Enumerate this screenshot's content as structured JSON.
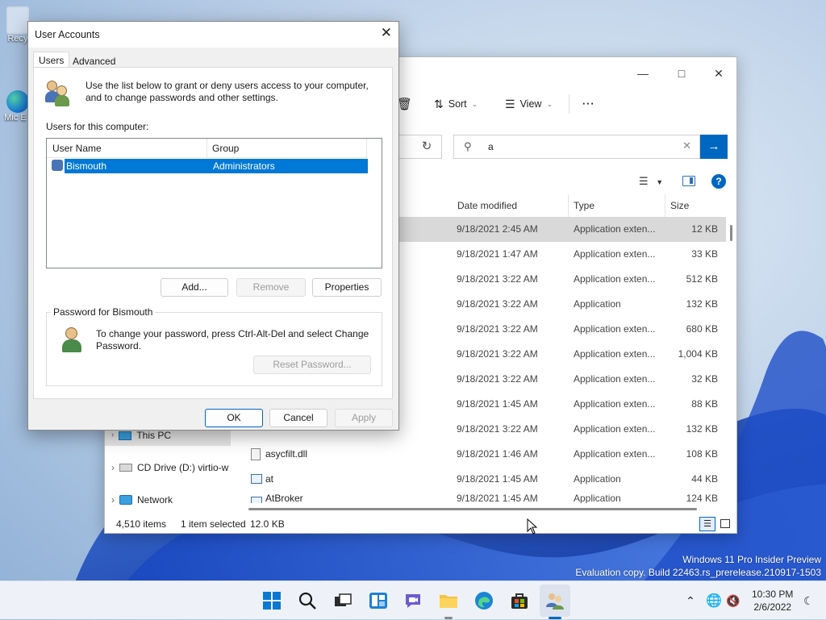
{
  "desktop": {
    "icons": [
      {
        "label": "Recy"
      },
      {
        "label": "Mic E"
      }
    ],
    "watermark": {
      "line1": "Windows 11 Pro Insider Preview",
      "line2": "Evaluation copy. Build 22463.rs_prerelease.210917-1503"
    }
  },
  "explorer": {
    "toolbar": {
      "sort": "Sort",
      "view": "View",
      "more": "···"
    },
    "search": {
      "value": "a"
    },
    "columns": {
      "date": "Date modified",
      "type": "Type",
      "size": "Size"
    },
    "rows": [
      {
        "date": "9/18/2021 2:45 AM",
        "type": "Application exten...",
        "size": "12 KB",
        "selected": true
      },
      {
        "date": "9/18/2021 1:47 AM",
        "type": "Application exten...",
        "size": "33 KB"
      },
      {
        "date": "9/18/2021 3:22 AM",
        "type": "Application exten...",
        "size": "512 KB"
      },
      {
        "date": "9/18/2021 3:22 AM",
        "type": "Application",
        "size": "132 KB"
      },
      {
        "date": "9/18/2021 3:22 AM",
        "type": "Application exten...",
        "size": "680 KB"
      },
      {
        "date": "9/18/2021 3:22 AM",
        "type": "Application exten...",
        "size": "1,004 KB"
      },
      {
        "date": "9/18/2021 3:22 AM",
        "type": "Application exten...",
        "size": "32 KB"
      },
      {
        "date": "9/18/2021 1:45 AM",
        "type": "Application exten...",
        "size": "88 KB"
      },
      {
        "date": "9/18/2021 3:22 AM",
        "type": "Application exten...",
        "size": "132 KB"
      },
      {
        "name": "asycfilt.dll",
        "date": "9/18/2021 1:46 AM",
        "type": "Application exten...",
        "size": "108 KB"
      },
      {
        "name": "at",
        "date": "9/18/2021 1:45 AM",
        "type": "Application",
        "size": "44 KB"
      },
      {
        "name": "AtBroker",
        "date": "9/18/2021 1:45 AM",
        "type": "Application",
        "size": "124 KB"
      }
    ],
    "nav": {
      "this_pc": "This PC",
      "cd_drive": "CD Drive (D:) virtio-w",
      "network": "Network"
    },
    "status": {
      "items": "4,510 items",
      "selected": "1 item selected",
      "size": "12.0 KB"
    }
  },
  "dialog": {
    "title": "User Accounts",
    "tabs": [
      "Users",
      "Advanced"
    ],
    "intro": "Use the list below to grant or deny users access to your computer, and to change passwords and other settings.",
    "users_label": "Users for this computer:",
    "list_columns": {
      "name": "User Name",
      "group": "Group"
    },
    "users": [
      {
        "name": "Bismouth",
        "group": "Administrators"
      }
    ],
    "buttons": {
      "add": "Add...",
      "remove": "Remove",
      "properties": "Properties",
      "reset": "Reset Password...",
      "ok": "OK",
      "cancel": "Cancel",
      "apply": "Apply"
    },
    "password_group": "Password for Bismouth",
    "password_text": "To change your password, press Ctrl-Alt-Del and select Change Password."
  },
  "taskbar": {
    "time": "10:30 PM",
    "date": "2/6/2022"
  }
}
